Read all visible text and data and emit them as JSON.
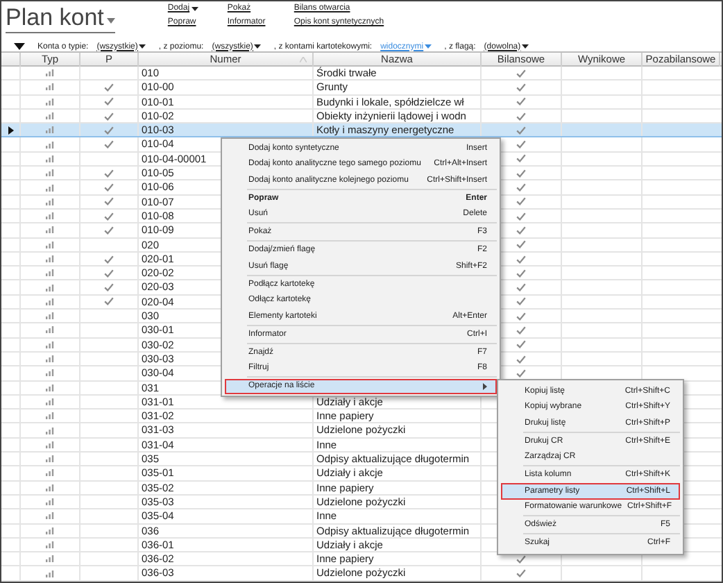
{
  "header": {
    "title": "Plan kont",
    "link_groups": [
      [
        {
          "label": "Dodaj",
          "has_menu": true
        },
        {
          "label": "Popraw",
          "has_menu": false
        }
      ],
      [
        {
          "label": "Pokaż",
          "has_menu": false
        },
        {
          "label": "Informator",
          "has_menu": false
        }
      ],
      [
        {
          "label": "Bilans otwarcia",
          "has_menu": false
        },
        {
          "label": "Opis kont syntetycznych",
          "has_menu": false
        }
      ]
    ]
  },
  "filters": [
    {
      "label": "Konta o typie:",
      "value": "(wszystkie)",
      "modified": false
    },
    {
      "label": ", z poziomu:",
      "value": "(wszystkie)",
      "modified": false
    },
    {
      "label": ", z kontami kartotekowymi:",
      "value": "widocznymi",
      "modified": true
    },
    {
      "label": ", z flagą:",
      "value": "(dowolna)",
      "modified": false
    }
  ],
  "table": {
    "columns": [
      {
        "label": "Typ",
        "sorted": false
      },
      {
        "label": "P",
        "sorted": false
      },
      {
        "label": "Numer",
        "sorted": true
      },
      {
        "label": "Nazwa",
        "sorted": false
      },
      {
        "label": "Bilansowe",
        "sorted": false
      },
      {
        "label": "Wynikowe",
        "sorted": false
      },
      {
        "label": "Pozabilansowe",
        "sorted": false
      }
    ],
    "rows": [
      {
        "p": false,
        "numer": "010",
        "nazwa": "Środki trwałe",
        "bilansowe": true,
        "selected": false
      },
      {
        "p": true,
        "numer": "010-00",
        "nazwa": "Grunty",
        "bilansowe": true,
        "selected": false
      },
      {
        "p": true,
        "numer": "010-01",
        "nazwa": "Budynki i lokale, spółdzielcze wł",
        "bilansowe": true,
        "selected": false
      },
      {
        "p": true,
        "numer": "010-02",
        "nazwa": "Obiekty inżynierii lądowej i wodn",
        "bilansowe": true,
        "selected": false
      },
      {
        "p": true,
        "numer": "010-03",
        "nazwa": "Kotły i maszyny energetyczne",
        "bilansowe": true,
        "selected": true
      },
      {
        "p": true,
        "numer": "010-04",
        "bilansowe": true,
        "selected": false
      },
      {
        "p": false,
        "numer": "010-04-00001",
        "bilansowe": true,
        "selected": false
      },
      {
        "p": true,
        "numer": "010-05",
        "bilansowe": true,
        "selected": false
      },
      {
        "p": true,
        "numer": "010-06",
        "bilansowe": true,
        "selected": false
      },
      {
        "p": true,
        "numer": "010-07",
        "bilansowe": true,
        "selected": false
      },
      {
        "p": true,
        "numer": "010-08",
        "bilansowe": true,
        "selected": false
      },
      {
        "p": true,
        "numer": "010-09",
        "bilansowe": true,
        "selected": false
      },
      {
        "p": false,
        "numer": "020",
        "bilansowe": true,
        "selected": false
      },
      {
        "p": true,
        "numer": "020-01",
        "bilansowe": true,
        "selected": false
      },
      {
        "p": true,
        "numer": "020-02",
        "bilansowe": true,
        "selected": false
      },
      {
        "p": true,
        "numer": "020-03",
        "bilansowe": true,
        "selected": false
      },
      {
        "p": true,
        "numer": "020-04",
        "bilansowe": true,
        "selected": false
      },
      {
        "p": false,
        "numer": "030",
        "bilansowe": true,
        "selected": false
      },
      {
        "p": false,
        "numer": "030-01",
        "bilansowe": true,
        "selected": false
      },
      {
        "p": false,
        "numer": "030-02",
        "bilansowe": true,
        "selected": false
      },
      {
        "p": false,
        "numer": "030-03",
        "bilansowe": true,
        "selected": false
      },
      {
        "p": false,
        "numer": "030-04",
        "bilansowe": true,
        "selected": false
      },
      {
        "p": false,
        "numer": "031",
        "selected": false
      },
      {
        "p": false,
        "numer": "031-01",
        "nazwa": "Udziały i akcje",
        "selected": false
      },
      {
        "p": false,
        "numer": "031-02",
        "nazwa": "Inne papiery",
        "selected": false
      },
      {
        "p": false,
        "numer": "031-03",
        "nazwa": "Udzielone pożyczki",
        "selected": false
      },
      {
        "p": false,
        "numer": "031-04",
        "nazwa": "Inne",
        "selected": false
      },
      {
        "p": false,
        "numer": "035",
        "nazwa": "Odpisy aktualizujące długotermin",
        "selected": false
      },
      {
        "p": false,
        "numer": "035-01",
        "nazwa": "Udziały i akcje",
        "selected": false
      },
      {
        "p": false,
        "numer": "035-02",
        "nazwa": "Inne papiery",
        "selected": false
      },
      {
        "p": false,
        "numer": "035-03",
        "nazwa": "Udzielone pożyczki",
        "selected": false
      },
      {
        "p": false,
        "numer": "035-04",
        "nazwa": "Inne",
        "selected": false
      },
      {
        "p": false,
        "numer": "036",
        "nazwa": "Odpisy aktualizujące długotermin",
        "selected": false
      },
      {
        "p": false,
        "numer": "036-01",
        "nazwa": "Udziały i akcje",
        "selected": false
      },
      {
        "p": false,
        "numer": "036-02",
        "nazwa": "Inne papiery",
        "bilansowe": true,
        "selected": false
      },
      {
        "p": false,
        "numer": "036-03",
        "nazwa": "Udzielone pożyczki",
        "bilansowe": true,
        "selected": false
      }
    ]
  },
  "context_menu": {
    "items": [
      {
        "kind": "item",
        "label": "Dodaj konto syntetyczne",
        "shortcut": "Insert",
        "bold": false,
        "selected": false
      },
      {
        "kind": "item",
        "label": "Dodaj konto analityczne tego samego poziomu",
        "shortcut": "Ctrl+Alt+Insert",
        "bold": false,
        "selected": false
      },
      {
        "kind": "item",
        "label": "Dodaj konto analityczne kolejnego poziomu",
        "shortcut": "Ctrl+Shift+Insert",
        "bold": false,
        "selected": false
      },
      {
        "kind": "separator"
      },
      {
        "kind": "item",
        "label": "Popraw",
        "shortcut": "Enter",
        "bold": true,
        "selected": false
      },
      {
        "kind": "item",
        "label": "Usuń",
        "shortcut": "Delete",
        "bold": false,
        "selected": false
      },
      {
        "kind": "separator"
      },
      {
        "kind": "item",
        "label": "Pokaż",
        "shortcut": "F3",
        "bold": false,
        "selected": false
      },
      {
        "kind": "separator"
      },
      {
        "kind": "item",
        "label": "Dodaj/zmień flagę",
        "shortcut": "F2",
        "bold": false,
        "selected": false
      },
      {
        "kind": "item",
        "label": "Usuń flagę",
        "shortcut": "Shift+F2",
        "bold": false,
        "selected": false
      },
      {
        "kind": "separator"
      },
      {
        "kind": "item",
        "label": "Podłącz kartotekę",
        "bold": false,
        "selected": false
      },
      {
        "kind": "item",
        "label": "Odłącz kartotekę",
        "bold": false,
        "selected": false
      },
      {
        "kind": "item",
        "label": "Elementy kartoteki",
        "shortcut": "Alt+Enter",
        "bold": false,
        "selected": false
      },
      {
        "kind": "separator"
      },
      {
        "kind": "item",
        "label": "Informator",
        "shortcut": "Ctrl+I",
        "bold": false,
        "selected": false
      },
      {
        "kind": "separator"
      },
      {
        "kind": "item",
        "label": "Znajdź",
        "shortcut": "F7",
        "bold": false,
        "selected": false
      },
      {
        "kind": "item",
        "label": "Filtruj",
        "shortcut": "F8",
        "bold": false,
        "selected": false
      },
      {
        "kind": "separator"
      },
      {
        "kind": "submenu",
        "label": "Operacje na liście",
        "bold": false,
        "selected": true
      }
    ]
  },
  "submenu": {
    "items": [
      {
        "kind": "item",
        "label": "Kopiuj listę",
        "shortcut": "Ctrl+Shift+C",
        "bold": false,
        "selected": false
      },
      {
        "kind": "item",
        "label": "Kopiuj wybrane",
        "shortcut": "Ctrl+Shift+Y",
        "bold": false,
        "selected": false
      },
      {
        "kind": "item",
        "label": "Drukuj listę",
        "shortcut": "Ctrl+Shift+P",
        "bold": false,
        "selected": false
      },
      {
        "kind": "separator"
      },
      {
        "kind": "item",
        "label": "Drukuj CR",
        "shortcut": "Ctrl+Shift+E",
        "bold": false,
        "selected": false
      },
      {
        "kind": "item",
        "label": "Zarządzaj CR",
        "bold": false,
        "selected": false
      },
      {
        "kind": "separator"
      },
      {
        "kind": "item",
        "label": "Lista kolumn",
        "shortcut": "Ctrl+Shift+K",
        "bold": false,
        "selected": false
      },
      {
        "kind": "item",
        "label": "Parametry listy",
        "shortcut": "Ctrl+Shift+L",
        "bold": false,
        "selected": true
      },
      {
        "kind": "item",
        "label": "Formatowanie warunkowe",
        "shortcut": "Ctrl+Shift+F",
        "bold": false,
        "selected": false
      },
      {
        "kind": "separator"
      },
      {
        "kind": "item",
        "label": "Odśwież",
        "shortcut": "F5",
        "bold": false,
        "selected": false
      },
      {
        "kind": "separator"
      },
      {
        "kind": "item",
        "label": "Szukaj",
        "shortcut": "Ctrl+F",
        "bold": false,
        "selected": false
      }
    ]
  }
}
